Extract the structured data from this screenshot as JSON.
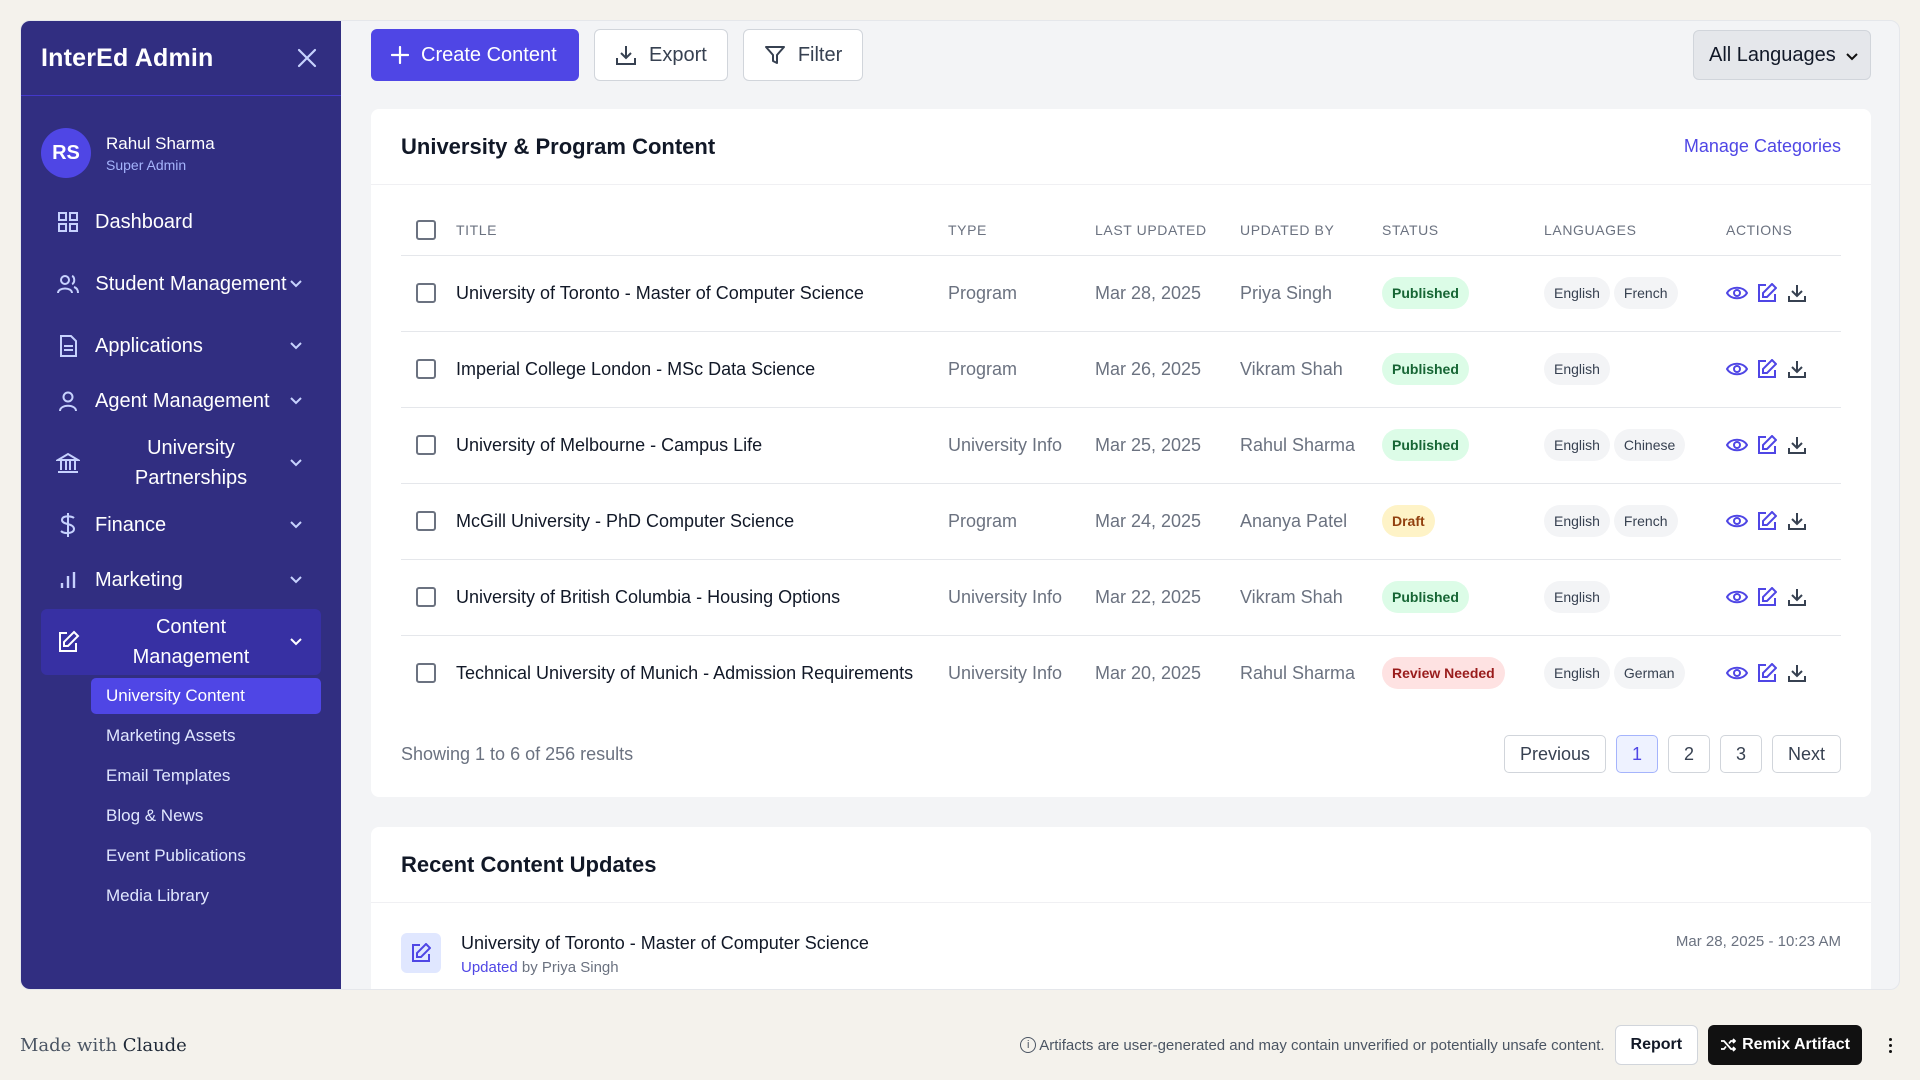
{
  "sidebar": {
    "title": "InterEd Admin",
    "user": {
      "initials": "RS",
      "name": "Rahul Sharma",
      "role": "Super Admin"
    },
    "nav": [
      {
        "label": "Dashboard"
      },
      {
        "label": "Student Management"
      },
      {
        "label": "Applications"
      },
      {
        "label": "Agent Management"
      },
      {
        "label": "University Partnerships"
      },
      {
        "label": "Finance"
      },
      {
        "label": "Marketing"
      },
      {
        "label": "Content Management"
      }
    ],
    "sub_items": [
      "University Content",
      "Marketing Assets",
      "Email Templates",
      "Blog & News",
      "Event Publications",
      "Media Library"
    ]
  },
  "toolbar": {
    "create_label": "Create Content",
    "export_label": "Export",
    "filter_label": "Filter",
    "language_select": "All Languages"
  },
  "content_card": {
    "title": "University & Program Content",
    "manage_link": "Manage Categories",
    "columns": [
      "TITLE",
      "TYPE",
      "LAST UPDATED",
      "UPDATED BY",
      "STATUS",
      "LANGUAGES",
      "ACTIONS"
    ],
    "rows": [
      {
        "title": "University of Toronto - Master of Computer Science",
        "type": "Program",
        "updated": "Mar 28, 2025",
        "by": "Priya Singh",
        "status": "Published",
        "languages": [
          "English",
          "French"
        ]
      },
      {
        "title": "Imperial College London - MSc Data Science",
        "type": "Program",
        "updated": "Mar 26, 2025",
        "by": "Vikram Shah",
        "status": "Published",
        "languages": [
          "English",
          ""
        ]
      },
      {
        "title": "University of Melbourne - Campus Life",
        "type": "University Info",
        "updated": "Mar 25, 2025",
        "by": "Rahul Sharma",
        "status": "Published",
        "languages": [
          "English",
          "Chinese"
        ]
      },
      {
        "title": "McGill University - PhD Computer Science",
        "type": "Program",
        "updated": "Mar 24, 2025",
        "by": "Ananya Patel",
        "status": "Draft",
        "languages": [
          "English",
          "French"
        ]
      },
      {
        "title": "University of British Columbia - Housing Options",
        "type": "University Info",
        "updated": "Mar 22, 2025",
        "by": "Vikram Shah",
        "status": "Published",
        "languages": [
          "English",
          ""
        ]
      },
      {
        "title": "Technical University of Munich - Admission Requirements",
        "type": "University Info",
        "updated": "Mar 20, 2025",
        "by": "Rahul Sharma",
        "status": "Review Needed",
        "languages": [
          "English",
          "German"
        ]
      }
    ],
    "showing": "Showing 1 to 6 of 256 results",
    "pager": {
      "prev": "Previous",
      "pages": [
        "1",
        "2",
        "3"
      ],
      "next": "Next"
    }
  },
  "recent_card": {
    "title": "Recent Content Updates",
    "item": {
      "title": "University of Toronto - Master of Computer Science",
      "action": "Updated",
      "by": "by Priya Singh",
      "time": "Mar 28, 2025 - 10:23 AM"
    }
  },
  "bottom_bar": {
    "made_with": "Made with",
    "brand": "Claude",
    "disclaimer": "Artifacts are user-generated and may contain unverified or potentially unsafe content.",
    "report": "Report",
    "remix": "Remix Artifact"
  },
  "colors": {
    "sidebar": "#312e81",
    "accent": "#4f46e5"
  }
}
